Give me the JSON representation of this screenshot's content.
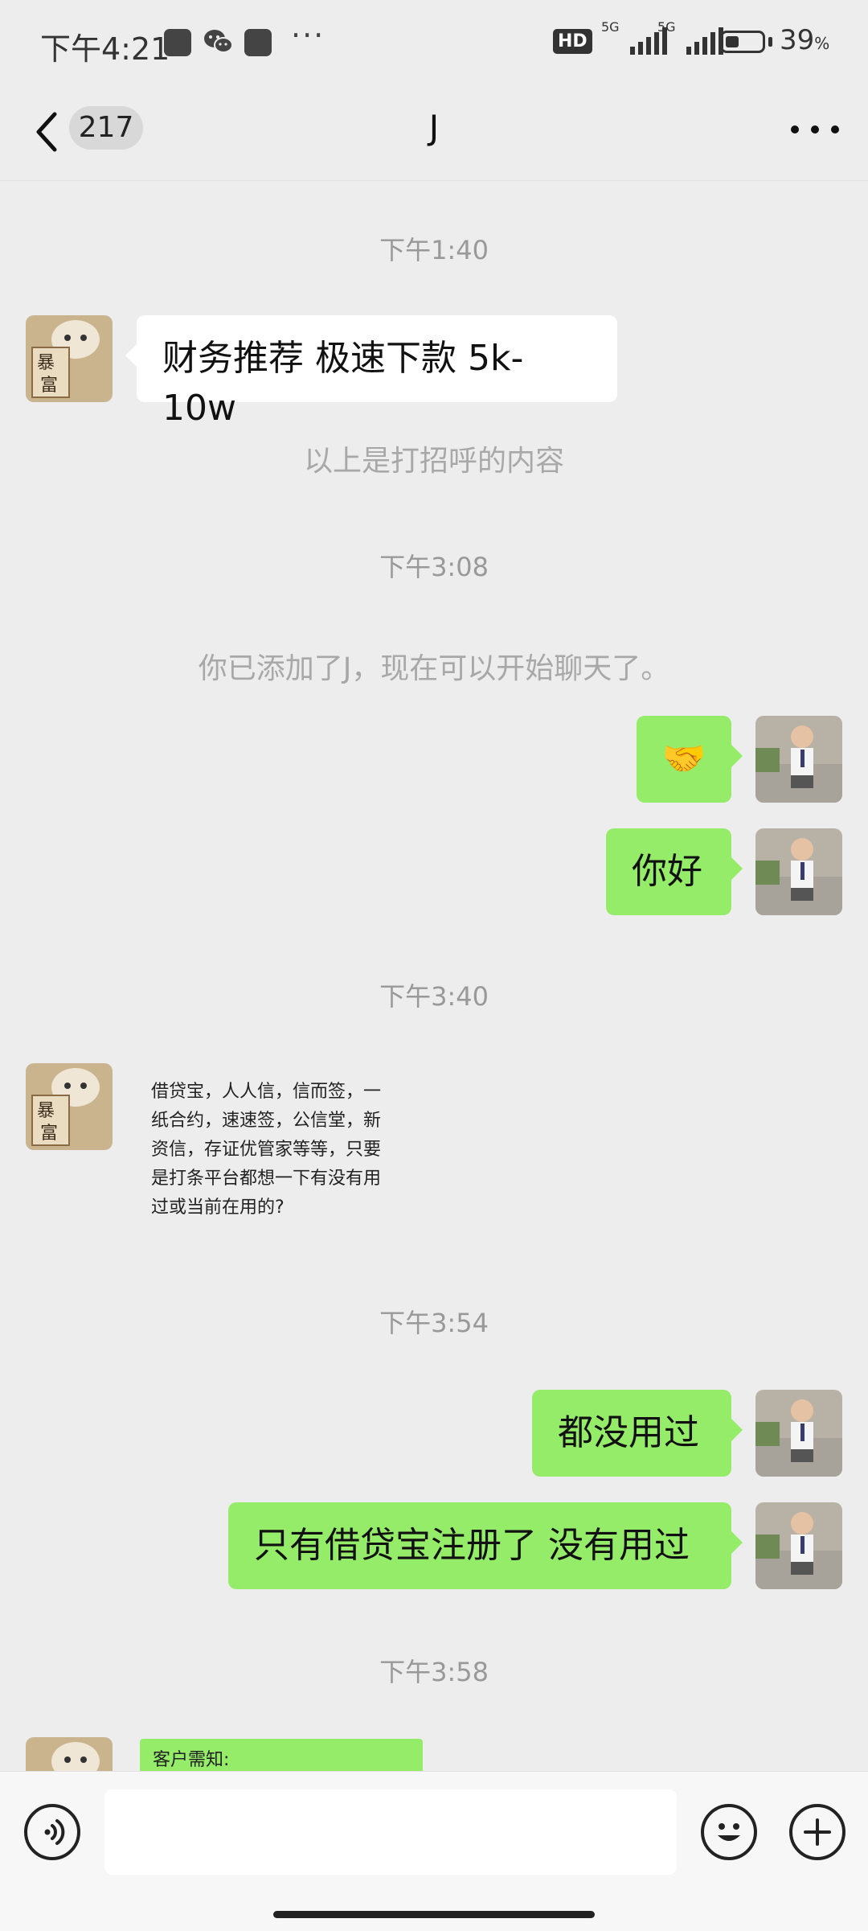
{
  "status_bar": {
    "time": "下午4:21",
    "dots": "···",
    "hd_label": "HD",
    "network_1": "5G",
    "network_2": "5G",
    "battery_level": 0.39,
    "battery_text": "39",
    "battery_unit": "%"
  },
  "header": {
    "unread_count": "217",
    "title": "J"
  },
  "messages": {
    "ts1": "下午1:40",
    "m1": "财务推荐 极速下款 5k-10w",
    "sys1": "以上是打招呼的内容",
    "ts2": "下午3:08",
    "sys2": "你已添加了J，现在可以开始聊天了。",
    "m2_emoji": "🤝",
    "m3": "你好",
    "ts3": "下午3:40",
    "m4_lines": [
      "借贷宝，人人信，信而签，一",
      "纸合约，速速签，公信堂，新",
      "资信，存证优管家等等，只要",
      "是打条平台都想一下有没有用",
      "过或当前在用的?"
    ],
    "ts4": "下午3:54",
    "m5": "都没用过",
    "m6": "只有借贷宝注册了 没有用过",
    "ts5": "下午3:58",
    "m7": "客户需知:"
  },
  "colors": {
    "background": "#ededed",
    "outgoing_bubble": "#95ec69",
    "incoming_bubble": "#ffffff"
  },
  "icons": [
    "back-arrow-icon",
    "more-icon",
    "voice-icon",
    "emoji-icon",
    "plus-icon"
  ]
}
